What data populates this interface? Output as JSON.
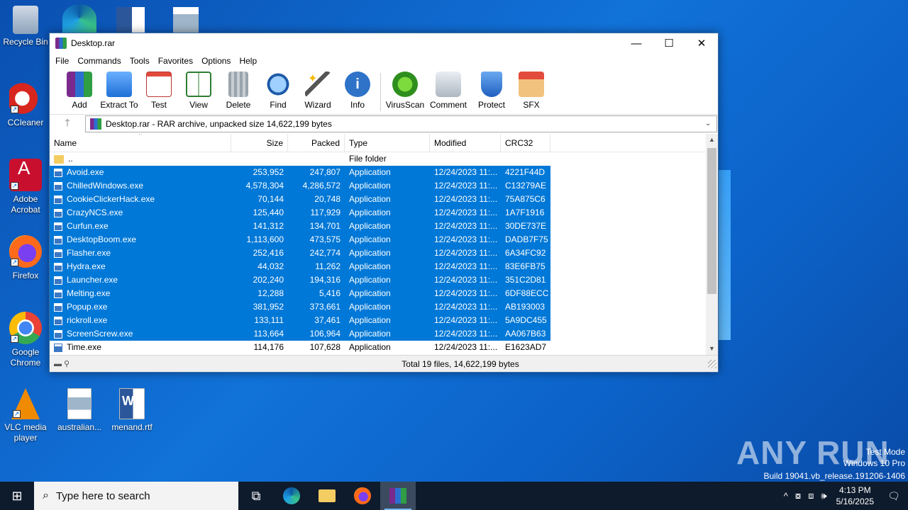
{
  "desktop": {
    "icons": [
      {
        "label": "Recycle Bin",
        "icon": "recycle-bin-icon"
      },
      {
        "label": "CCleaner",
        "icon": "ccleaner-icon"
      },
      {
        "label": "Adobe Acrobat",
        "icon": "acrobat-icon"
      },
      {
        "label": "Firefox",
        "icon": "firefox-icon"
      },
      {
        "label": "Google Chrome",
        "icon": "chrome-icon"
      },
      {
        "label": "VLC media player",
        "icon": "vlc-icon"
      },
      {
        "label": "australian...",
        "icon": "image-file-icon"
      },
      {
        "label": "menand.rtf",
        "icon": "word-doc-icon"
      }
    ]
  },
  "window": {
    "title": "Desktop.rar",
    "menu": [
      "File",
      "Commands",
      "Tools",
      "Favorites",
      "Options",
      "Help"
    ],
    "toolbar": [
      "Add",
      "Extract To",
      "Test",
      "View",
      "Delete",
      "Find",
      "Wizard",
      "Info",
      "VirusScan",
      "Comment",
      "Protect",
      "SFX"
    ],
    "address": "Desktop.rar - RAR archive, unpacked size 14,622,199 bytes",
    "columns": {
      "name": "Name",
      "size": "Size",
      "packed": "Packed",
      "type": "Type",
      "modified": "Modified",
      "crc": "CRC32"
    },
    "parent_row": {
      "name": "..",
      "type": "File folder"
    },
    "files": [
      {
        "name": "Avoid.exe",
        "size": "253,952",
        "packed": "247,807",
        "type": "Application",
        "modified": "12/24/2023 11:...",
        "crc": "4221F44D",
        "selected": true
      },
      {
        "name": "ChilledWindows.exe",
        "size": "4,578,304",
        "packed": "4,286,572",
        "type": "Application",
        "modified": "12/24/2023 11:...",
        "crc": "C13279AE",
        "selected": true
      },
      {
        "name": "CookieClickerHack.exe",
        "size": "70,144",
        "packed": "20,748",
        "type": "Application",
        "modified": "12/24/2023 11:...",
        "crc": "75A875C6",
        "selected": true
      },
      {
        "name": "CrazyNCS.exe",
        "size": "125,440",
        "packed": "117,929",
        "type": "Application",
        "modified": "12/24/2023 11:...",
        "crc": "1A7F1916",
        "selected": true
      },
      {
        "name": "Curfun.exe",
        "size": "141,312",
        "packed": "134,701",
        "type": "Application",
        "modified": "12/24/2023 11:...",
        "crc": "30DE737E",
        "selected": true
      },
      {
        "name": "DesktopBoom.exe",
        "size": "1,113,600",
        "packed": "473,575",
        "type": "Application",
        "modified": "12/24/2023 11:...",
        "crc": "DADB7F75",
        "selected": true
      },
      {
        "name": "Flasher.exe",
        "size": "252,416",
        "packed": "242,774",
        "type": "Application",
        "modified": "12/24/2023 11:...",
        "crc": "6A34FC92",
        "selected": true
      },
      {
        "name": "Hydra.exe",
        "size": "44,032",
        "packed": "11,262",
        "type": "Application",
        "modified": "12/24/2023 11:...",
        "crc": "83E6FB75",
        "selected": true
      },
      {
        "name": "Launcher.exe",
        "size": "202,240",
        "packed": "194,316",
        "type": "Application",
        "modified": "12/24/2023 11:...",
        "crc": "351C2D81",
        "selected": true
      },
      {
        "name": "Melting.exe",
        "size": "12,288",
        "packed": "5,416",
        "type": "Application",
        "modified": "12/24/2023 11:...",
        "crc": "6DF88ECC",
        "selected": true
      },
      {
        "name": "Popup.exe",
        "size": "381,952",
        "packed": "373,661",
        "type": "Application",
        "modified": "12/24/2023 11:...",
        "crc": "AB193003",
        "selected": true
      },
      {
        "name": "rickroll.exe",
        "size": "133,111",
        "packed": "37,461",
        "type": "Application",
        "modified": "12/24/2023 11:...",
        "crc": "5A9DC455",
        "selected": true
      },
      {
        "name": "ScreenScrew.exe",
        "size": "113,664",
        "packed": "106,964",
        "type": "Application",
        "modified": "12/24/2023 11:...",
        "crc": "AA067B63",
        "selected": true
      },
      {
        "name": "Time.exe",
        "size": "114,176",
        "packed": "107,628",
        "type": "Application",
        "modified": "12/24/2023 11:...",
        "crc": "E1623AD7",
        "selected": false
      }
    ],
    "status": "Total 19 files, 14,622,199 bytes"
  },
  "watermark": {
    "brand": "ANY RUN",
    "test_mode": "Test Mode",
    "edition": "Windows 10 Pro",
    "build": "Build 19041.vb_release.191206-1406"
  },
  "taskbar": {
    "search_placeholder": "Type here to search",
    "time": "4:13 PM",
    "date": "5/16/2025"
  },
  "colors": {
    "selection": "#0078d7",
    "taskbar": "#0e1b2c",
    "desktop": "#0f6ad0"
  }
}
